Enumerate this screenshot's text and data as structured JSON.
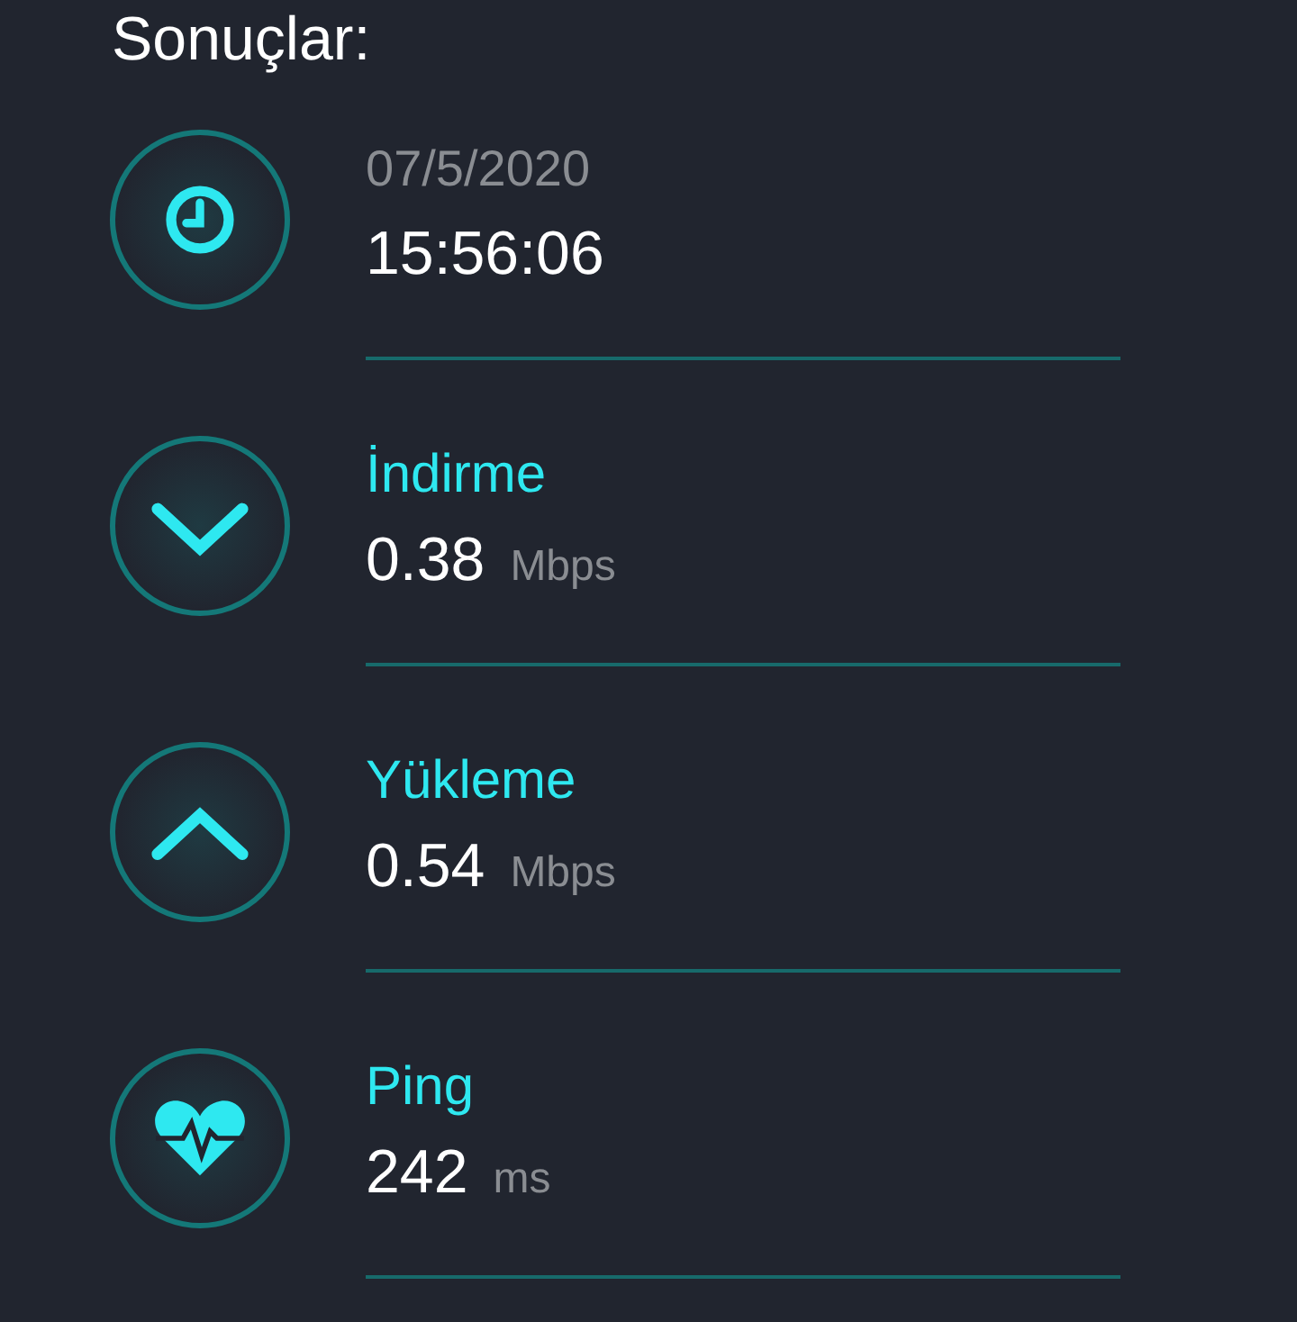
{
  "title": "Sonuçlar:",
  "results": [
    {
      "kind": "time",
      "label": "07/5/2020",
      "value": "15:56:06"
    },
    {
      "kind": "download",
      "label": "İndirme",
      "value": "0.38",
      "unit": "Mbps"
    },
    {
      "kind": "upload",
      "label": "Yükleme",
      "value": "0.54",
      "unit": "Mbps"
    },
    {
      "kind": "ping",
      "label": "Ping",
      "value": "242",
      "unit": "ms"
    }
  ]
}
